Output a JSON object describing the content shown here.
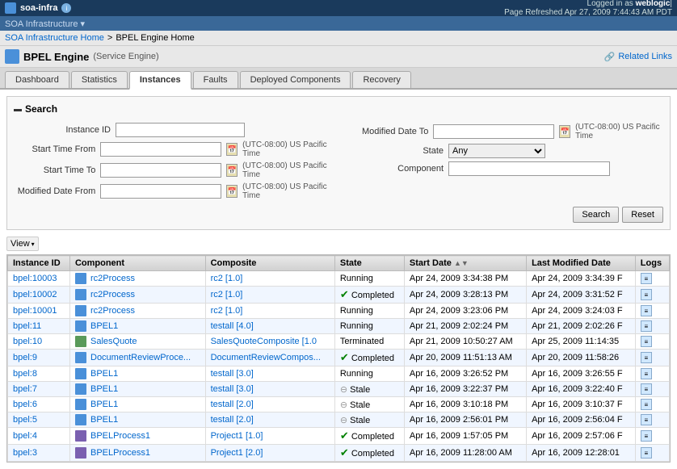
{
  "app": {
    "name": "soa-infra",
    "subtitle": "SOA Infrastructure",
    "logged_in_text": "Logged in as",
    "user": "weblogic",
    "page_refreshed": "Page Refreshed Apr 27, 2009 7:44:43 AM PDT"
  },
  "sub_header": {
    "label": "SOA Infrastructure ▾"
  },
  "breadcrumb": {
    "home": "SOA Infrastructure Home",
    "separator": ">",
    "current": "BPEL Engine Home"
  },
  "page_title": {
    "engine": "BPEL Engine",
    "subtitle": "(Service Engine)"
  },
  "related_links": "Related Links",
  "tabs": [
    {
      "id": "dashboard",
      "label": "Dashboard",
      "active": false
    },
    {
      "id": "statistics",
      "label": "Statistics",
      "active": false
    },
    {
      "id": "instances",
      "label": "Instances",
      "active": true
    },
    {
      "id": "faults",
      "label": "Faults",
      "active": false
    },
    {
      "id": "deployed-components",
      "label": "Deployed Components",
      "active": false
    },
    {
      "id": "recovery",
      "label": "Recovery",
      "active": false
    }
  ],
  "search": {
    "title": "Search",
    "fields": {
      "instance_id_label": "Instance ID",
      "start_time_from_label": "Start Time From",
      "start_time_to_label": "Start Time To",
      "modified_date_from_label": "Modified Date From",
      "modified_date_to_label": "Modified Date To",
      "state_label": "State",
      "component_label": "Component",
      "tz": "(UTC-08:00) US Pacific Time",
      "state_value": "Any"
    },
    "buttons": {
      "search": "Search",
      "reset": "Reset"
    }
  },
  "view": {
    "label": "View",
    "arrow": "▾"
  },
  "table": {
    "columns": [
      "Instance ID",
      "Component",
      "Composite",
      "State",
      "Start Date",
      "Last Modified Date",
      "Logs"
    ],
    "rows": [
      {
        "instance_id": "bpel:10003",
        "component": "rc2Process",
        "composite": "rc2 [1.0]",
        "state": "Running",
        "state_type": "running",
        "start_date": "Apr 24, 2009 3:34:38 PM",
        "last_modified": "Apr 24, 2009 3:34:39 F",
        "has_check": false
      },
      {
        "instance_id": "bpel:10002",
        "component": "rc2Process",
        "composite": "rc2 [1.0]",
        "state": "Completed",
        "state_type": "completed",
        "start_date": "Apr 24, 2009 3:28:13 PM",
        "last_modified": "Apr 24, 2009 3:31:52 F",
        "has_check": true
      },
      {
        "instance_id": "bpel:10001",
        "component": "rc2Process",
        "composite": "rc2 [1.0]",
        "state": "Running",
        "state_type": "running",
        "start_date": "Apr 24, 2009 3:23:06 PM",
        "last_modified": "Apr 24, 2009 3:24:03 F",
        "has_check": false
      },
      {
        "instance_id": "bpel:11",
        "component": "BPEL1",
        "composite": "testall [4.0]",
        "state": "Running",
        "state_type": "running",
        "start_date": "Apr 21, 2009 2:02:24 PM",
        "last_modified": "Apr 21, 2009 2:02:26 F",
        "has_check": false
      },
      {
        "instance_id": "bpel:10",
        "component": "SalesQuote",
        "composite": "SalesQuoteComposite [1.0",
        "state": "Terminated",
        "state_type": "terminated",
        "start_date": "Apr 21, 2009 10:50:27 AM",
        "last_modified": "Apr 25, 2009 11:14:35",
        "has_check": false
      },
      {
        "instance_id": "bpel:9",
        "component": "DocumentReviewProce...",
        "composite": "DocumentReviewCompos...",
        "state": "Completed",
        "state_type": "completed",
        "start_date": "Apr 20, 2009 11:51:13 AM",
        "last_modified": "Apr 20, 2009 11:58:26",
        "has_check": true
      },
      {
        "instance_id": "bpel:8",
        "component": "BPEL1",
        "composite": "testall [3.0]",
        "state": "Running",
        "state_type": "running",
        "start_date": "Apr 16, 2009 3:26:52 PM",
        "last_modified": "Apr 16, 2009 3:26:55 F",
        "has_check": false
      },
      {
        "instance_id": "bpel:7",
        "component": "BPEL1",
        "composite": "testall [3.0]",
        "state": "Stale",
        "state_type": "stale",
        "start_date": "Apr 16, 2009 3:22:37 PM",
        "last_modified": "Apr 16, 2009 3:22:40 F",
        "has_check": false
      },
      {
        "instance_id": "bpel:6",
        "component": "BPEL1",
        "composite": "testall [2.0]",
        "state": "Stale",
        "state_type": "stale",
        "start_date": "Apr 16, 2009 3:10:18 PM",
        "last_modified": "Apr 16, 2009 3:10:37 F",
        "has_check": false
      },
      {
        "instance_id": "bpel:5",
        "component": "BPEL1",
        "composite": "testall [2.0]",
        "state": "Stale",
        "state_type": "stale",
        "start_date": "Apr 16, 2009 2:56:01 PM",
        "last_modified": "Apr 16, 2009 2:56:04 F",
        "has_check": false
      },
      {
        "instance_id": "bpel:4",
        "component": "BPELProcess1",
        "composite": "Project1 [1.0]",
        "state": "Completed",
        "state_type": "completed",
        "start_date": "Apr 16, 2009 1:57:05 PM",
        "last_modified": "Apr 16, 2009 2:57:06 F",
        "has_check": true
      },
      {
        "instance_id": "bpel:3",
        "component": "BPELProcess1",
        "composite": "Project1 [2.0]",
        "state": "Completed",
        "state_type": "completed",
        "start_date": "Apr 16, 2009 11:28:00 AM",
        "last_modified": "Apr 16, 2009 12:28:01",
        "has_check": true
      }
    ]
  }
}
